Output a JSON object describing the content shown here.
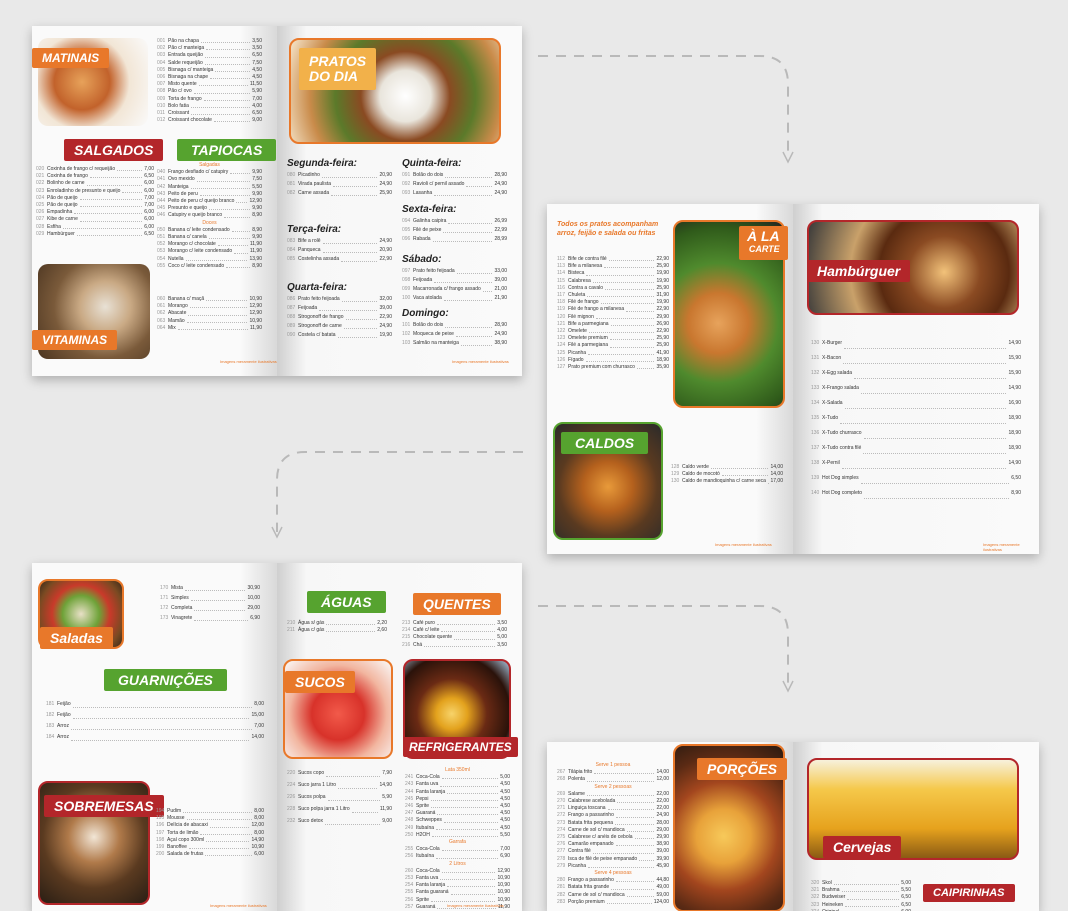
{
  "matinais": {
    "title": "MATINAIS",
    "items": [
      {
        "n": "001",
        "name": "Pão na chapa",
        "price": "3,50"
      },
      {
        "n": "002",
        "name": "Pão c/ manteiga",
        "price": "3,50"
      },
      {
        "n": "003",
        "name": "Entrada queijão",
        "price": "6,50"
      },
      {
        "n": "004",
        "name": "Salde requeijão",
        "price": "7,50"
      },
      {
        "n": "005",
        "name": "Bisnaga c/ manteiga",
        "price": "4,50"
      },
      {
        "n": "006",
        "name": "Bisnaga na chape",
        "price": "4,50"
      },
      {
        "n": "007",
        "name": "Misto quente",
        "price": "11,50"
      },
      {
        "n": "008",
        "name": "Pão c/ ovo",
        "price": "5,90"
      },
      {
        "n": "009",
        "name": "Torta de frango",
        "price": "7,00"
      },
      {
        "n": "010",
        "name": "Bolo fatia",
        "price": "4,00"
      },
      {
        "n": "011",
        "name": "Croissant",
        "price": "6,50"
      },
      {
        "n": "012",
        "name": "Croissant chocolate",
        "price": "9,00"
      }
    ]
  },
  "salgados": {
    "title": "SALGADOS",
    "items": [
      {
        "n": "020",
        "name": "Coxinha de frango c/ requeijão",
        "price": "7,00"
      },
      {
        "n": "021",
        "name": "Coxinha de frango",
        "price": "6,50"
      },
      {
        "n": "022",
        "name": "Bolinho de carne",
        "price": "6,00"
      },
      {
        "n": "023",
        "name": "Enroladinho de presunto e queijo",
        "price": "6,00"
      },
      {
        "n": "024",
        "name": "Pão de queijo",
        "price": "7,00"
      },
      {
        "n": "025",
        "name": "Pão de queijo",
        "price": "7,00"
      },
      {
        "n": "026",
        "name": "Empadinha",
        "price": "6,00"
      },
      {
        "n": "027",
        "name": "Kibe de carne",
        "price": "6,00"
      },
      {
        "n": "028",
        "name": "Esfiha",
        "price": "6,00"
      },
      {
        "n": "029",
        "name": "Hambúrguer",
        "price": "6,50"
      }
    ]
  },
  "tapiocas": {
    "title": "TAPIOCAS",
    "section1": "Salgadas",
    "section2": "Doces",
    "items1": [
      {
        "n": "040",
        "name": "Frango desfiado c/ catupiry",
        "price": "9,90"
      },
      {
        "n": "041",
        "name": "Ovo mexido",
        "price": "7,50"
      },
      {
        "n": "042",
        "name": "Manteiga",
        "price": "5,50"
      },
      {
        "n": "043",
        "name": "Peito de peru",
        "price": "9,90"
      },
      {
        "n": "044",
        "name": "Peito de peru c/ queijo branco",
        "price": "12,90"
      },
      {
        "n": "045",
        "name": "Presunto e queijo",
        "price": "9,90"
      },
      {
        "n": "046",
        "name": "Catupiry e queijo branco",
        "price": "8,90"
      }
    ],
    "items2": [
      {
        "n": "050",
        "name": "Banana c/ leite condensado",
        "price": "8,90"
      },
      {
        "n": "051",
        "name": "Banana c/ canela",
        "price": "9,90"
      },
      {
        "n": "052",
        "name": "Morango c/ chocolate",
        "price": "11,90"
      },
      {
        "n": "053",
        "name": "Morango c/ leite condensado",
        "price": "11,90"
      },
      {
        "n": "054",
        "name": "Nutella",
        "price": "13,90"
      },
      {
        "n": "055",
        "name": "Coco c/ leite condensado",
        "price": "8,90"
      }
    ]
  },
  "vitaminas": {
    "title": "VITAMINAS",
    "items": [
      {
        "n": "060",
        "name": "Banana c/ maçã",
        "price": "10,90"
      },
      {
        "n": "061",
        "name": "Morango",
        "price": "12,90"
      },
      {
        "n": "062",
        "name": "Abacate",
        "price": "12,90"
      },
      {
        "n": "063",
        "name": "Mamão",
        "price": "10,90"
      },
      {
        "n": "064",
        "name": "Mix",
        "price": "11,90"
      }
    ]
  },
  "pratos_do_dia": {
    "title_line1": "PRATOS",
    "title_line2": "DO DIA",
    "segunda": {
      "title": "Segunda-feira:",
      "items": [
        {
          "n": "080",
          "name": "Picadinho",
          "price": "20,90"
        },
        {
          "n": "081",
          "name": "Virada paulista",
          "price": "24,90"
        },
        {
          "n": "082",
          "name": "Carne assada",
          "price": "25,90"
        }
      ]
    },
    "terca": {
      "title": "Terça-feira:",
      "items": [
        {
          "n": "083",
          "name": "Bife a rolê",
          "price": "24,90"
        },
        {
          "n": "084",
          "name": "Panqueca",
          "price": "20,90"
        },
        {
          "n": "085",
          "name": "Costelinha assada",
          "price": "22,90"
        }
      ]
    },
    "quarta": {
      "title": "Quarta-feira:",
      "items": [
        {
          "n": "086",
          "name": "Prato feito feijoada",
          "price": "32,00"
        },
        {
          "n": "087",
          "name": "Feijoada",
          "price": "39,00"
        },
        {
          "n": "088",
          "name": "Strogonoff de frango",
          "price": "22,90"
        },
        {
          "n": "089",
          "name": "Strogonoff de carne",
          "price": "24,90"
        },
        {
          "n": "090",
          "name": "Costela c/ batata",
          "price": "19,90"
        }
      ]
    },
    "quinta": {
      "title": "Quinta-feira:",
      "items": [
        {
          "n": "091",
          "name": "Bolão do dois",
          "price": "28,90"
        },
        {
          "n": "092",
          "name": "Ravioli c/ pernil assado",
          "price": "24,90"
        },
        {
          "n": "093",
          "name": "Lasanha",
          "price": "24,90"
        }
      ]
    },
    "sexta": {
      "title": "Sexta-feira:",
      "items": [
        {
          "n": "094",
          "name": "Galinha caipira",
          "price": "26,99"
        },
        {
          "n": "095",
          "name": "Filé de peixe",
          "price": "22,99"
        },
        {
          "n": "096",
          "name": "Rabada",
          "price": "28,99"
        }
      ]
    },
    "sabado": {
      "title": "Sábado:",
      "items": [
        {
          "n": "097",
          "name": "Prato feito feijoada",
          "price": "33,00"
        },
        {
          "n": "098",
          "name": "Feijoada",
          "price": "39,00"
        },
        {
          "n": "099",
          "name": "Macarronada c/ frango assado",
          "price": "21,00"
        },
        {
          "n": "100",
          "name": "Vaca atolada",
          "price": "21,90"
        }
      ]
    },
    "domingo": {
      "title": "Domingo:",
      "items": [
        {
          "n": "101",
          "name": "Bolão do dois",
          "price": "28,90"
        },
        {
          "n": "102",
          "name": "Moqueca de peixe",
          "price": "24,90"
        },
        {
          "n": "103",
          "name": "Salmão na manteiga",
          "price": "38,90"
        }
      ]
    }
  },
  "a_la_carte": {
    "intro": "Todos os pratos acompanham arroz, feijão e salada ou fritas",
    "title_line1": "À LA",
    "title_line2": "CARTE",
    "items": [
      {
        "n": "112",
        "name": "Bife de contra filé",
        "price": "22,90"
      },
      {
        "n": "113",
        "name": "Bife a milanesa",
        "price": "25,90"
      },
      {
        "n": "114",
        "name": "Bisteca",
        "price": "19,90"
      },
      {
        "n": "115",
        "name": "Calabresa",
        "price": "19,90"
      },
      {
        "n": "116",
        "name": "Contra a cavalo",
        "price": "25,90"
      },
      {
        "n": "117",
        "name": "Chuleta",
        "price": "31,90"
      },
      {
        "n": "118",
        "name": "Filé de frango",
        "price": "19,90"
      },
      {
        "n": "119",
        "name": "Filé de frango a milanesa",
        "price": "22,90"
      },
      {
        "n": "120",
        "name": "Filé mignon",
        "price": "29,90"
      },
      {
        "n": "121",
        "name": "Bife a parmegiana",
        "price": "26,90"
      },
      {
        "n": "122",
        "name": "Omelete",
        "price": "22,90"
      },
      {
        "n": "123",
        "name": "Omelete premium",
        "price": "25,90"
      },
      {
        "n": "124",
        "name": "Filé a parmegiana",
        "price": "25,90"
      },
      {
        "n": "125",
        "name": "Picanha",
        "price": "41,90"
      },
      {
        "n": "126",
        "name": "Fígado",
        "price": "18,90"
      },
      {
        "n": "127",
        "name": "Prato premium com churrasco",
        "price": "35,90"
      }
    ]
  },
  "caldos": {
    "title": "CALDOS",
    "items": [
      {
        "n": "128",
        "name": "Caldo verde",
        "price": "14,00"
      },
      {
        "n": "129",
        "name": "Caldo de mocotó",
        "price": "14,00"
      },
      {
        "n": "130",
        "name": "Caldo de mandioquinha c/ carne seca",
        "price": "17,00"
      }
    ]
  },
  "hamburguer": {
    "title": "Hambúrguer",
    "items": [
      {
        "n": "130",
        "name": "X-Burger",
        "price": "14,90"
      },
      {
        "n": "131",
        "name": "X-Bacon",
        "price": "15,90"
      },
      {
        "n": "132",
        "name": "X-Egg salada",
        "price": "15,90"
      },
      {
        "n": "133",
        "name": "X-Frango salada",
        "price": "14,90"
      },
      {
        "n": "134",
        "name": "X-Salada",
        "price": "16,90"
      },
      {
        "n": "135",
        "name": "X-Tudo",
        "price": "18,90"
      },
      {
        "n": "136",
        "name": "X-Tudo churrasco",
        "price": "18,90"
      },
      {
        "n": "137",
        "name": "X-Tudo contra filé",
        "price": "18,90"
      },
      {
        "n": "138",
        "name": "X-Pernil",
        "price": "14,90"
      },
      {
        "n": "139",
        "name": "Hot Dog simples",
        "price": "6,50"
      },
      {
        "n": "140",
        "name": "Hot Dog completo",
        "price": "8,90"
      }
    ]
  },
  "saladas": {
    "title": "Saladas",
    "items": [
      {
        "n": "170",
        "name": "Mista",
        "price": "30,90"
      },
      {
        "n": "171",
        "name": "Simples",
        "price": "10,00"
      },
      {
        "n": "172",
        "name": "Completa",
        "price": "29,00"
      },
      {
        "n": "173",
        "name": "Vinagrete",
        "price": "6,90"
      }
    ]
  },
  "guarnicoes": {
    "title": "GUARNIÇÕES",
    "items": [
      {
        "n": "181",
        "name": "Feijão",
        "price": "8,00"
      },
      {
        "n": "182",
        "name": "Feijão",
        "price": "15,00"
      },
      {
        "n": "183",
        "name": "Arroz",
        "price": "7,00"
      },
      {
        "n": "184",
        "name": "Arroz",
        "price": "14,00"
      }
    ]
  },
  "sobremesas": {
    "title": "SOBREMESAS",
    "items": [
      {
        "n": "194",
        "name": "Pudim",
        "price": "8,00"
      },
      {
        "n": "195",
        "name": "Mousse",
        "price": "8,00"
      },
      {
        "n": "196",
        "name": "Delícia de abacaxi",
        "price": "12,00"
      },
      {
        "n": "197",
        "name": "Torta de limão",
        "price": "8,00"
      },
      {
        "n": "198",
        "name": "Açaí copo 300ml",
        "price": "14,90"
      },
      {
        "n": "199",
        "name": "Banoffee",
        "price": "10,90"
      },
      {
        "n": "200",
        "name": "Salada de frutas",
        "price": "6,00"
      }
    ]
  },
  "aguas": {
    "title": "ÁGUAS",
    "items": [
      {
        "n": "210",
        "name": "Água s/ gás",
        "price": "2,20"
      },
      {
        "n": "211",
        "name": "Água c/ gás",
        "price": "2,60"
      }
    ]
  },
  "quentes": {
    "title": "QUENTES",
    "items": [
      {
        "n": "213",
        "name": "Café puro",
        "price": "3,50"
      },
      {
        "n": "214",
        "name": "Café c/ leite",
        "price": "4,00"
      },
      {
        "n": "215",
        "name": "Chocolate quente",
        "price": "5,00"
      },
      {
        "n": "216",
        "name": "Chá",
        "price": "3,50"
      }
    ]
  },
  "sucos": {
    "title": "SUCOS",
    "items": [
      {
        "n": "220",
        "name": "Sucos copo",
        "price": "7,90"
      },
      {
        "n": "224",
        "name": "Suco jarra 1 Litro",
        "price": "14,90"
      },
      {
        "n": "226",
        "name": "Sucos polpa",
        "price": "5,90"
      },
      {
        "n": "228",
        "name": "Suco polpa jarra 1 Litro",
        "price": "11,90"
      },
      {
        "n": "232",
        "name": "Suco detox",
        "price": "9,00"
      }
    ]
  },
  "refrigerantes": {
    "title": "REFRIGERANTES",
    "section1": "Lata 350ml",
    "section2": "Garrafa",
    "section3": "2 Litros",
    "items1": [
      {
        "n": "241",
        "name": "Coca-Cola",
        "price": "5,00"
      },
      {
        "n": "243",
        "name": "Fanta uva",
        "price": "4,50"
      },
      {
        "n": "244",
        "name": "Fanta laranja",
        "price": "4,50"
      },
      {
        "n": "245",
        "name": "Pepsi",
        "price": "4,50"
      },
      {
        "n": "246",
        "name": "Sprite",
        "price": "4,50"
      },
      {
        "n": "247",
        "name": "Guaraná",
        "price": "4,50"
      },
      {
        "n": "248",
        "name": "Schweppes",
        "price": "4,50"
      },
      {
        "n": "249",
        "name": "Itubaína",
        "price": "4,50"
      },
      {
        "n": "250",
        "name": "H2OH",
        "price": "5,50"
      }
    ],
    "items2": [
      {
        "n": "255",
        "name": "Coca-Cola",
        "price": "7,00"
      },
      {
        "n": "256",
        "name": "Itubaína",
        "price": "6,90"
      }
    ],
    "items3": [
      {
        "n": "260",
        "name": "Coca-Cola",
        "price": "12,90"
      },
      {
        "n": "253",
        "name": "Fanta uva",
        "price": "10,90"
      },
      {
        "n": "254",
        "name": "Fanta laranja",
        "price": "10,90"
      },
      {
        "n": "255",
        "name": "Fanta guaraná",
        "price": "10,90"
      },
      {
        "n": "256",
        "name": "Sprite",
        "price": "10,90"
      },
      {
        "n": "257",
        "name": "Guaraná",
        "price": "11,90"
      }
    ]
  },
  "porcoes": {
    "title": "PORÇÕES",
    "section1": "Serve 1 pessoa",
    "section2": "Serve 2 pessoas",
    "section3": "Serve 4 pessoas",
    "items1": [
      {
        "n": "267",
        "name": "Tilápia frito",
        "price": "14,00"
      },
      {
        "n": "268",
        "name": "Polenta",
        "price": "12,00"
      }
    ],
    "items2": [
      {
        "n": "269",
        "name": "Salame",
        "price": "22,00"
      },
      {
        "n": "270",
        "name": "Calabrese acebolada",
        "price": "22,00"
      },
      {
        "n": "271",
        "name": "Linguiça toscana",
        "price": "22,00"
      },
      {
        "n": "272",
        "name": "Frango a passarinho",
        "price": "24,90"
      },
      {
        "n": "273",
        "name": "Batata frita pequena",
        "price": "28,00"
      },
      {
        "n": "274",
        "name": "Carne de sol c/ mandioca",
        "price": "29,00"
      },
      {
        "n": "275",
        "name": "Calabrese c/ anéis de cebola",
        "price": "29,90"
      },
      {
        "n": "276",
        "name": "Camarão empanado",
        "price": "38,90"
      },
      {
        "n": "277",
        "name": "Contra filé",
        "price": "39,00"
      },
      {
        "n": "278",
        "name": "Isca de filé de peixe empanado",
        "price": "39,90"
      },
      {
        "n": "279",
        "name": "Picanha",
        "price": "45,90"
      }
    ],
    "items3": [
      {
        "n": "280",
        "name": "Frango a passarinho",
        "price": "44,80"
      },
      {
        "n": "281",
        "name": "Batata frita grande",
        "price": "49,00"
      },
      {
        "n": "282",
        "name": "Carne de sol c/ mandioca",
        "price": "59,00"
      },
      {
        "n": "283",
        "name": "Porção premium",
        "price": "124,00"
      }
    ]
  },
  "cervejas": {
    "title": "Cervejas",
    "items": [
      {
        "n": "320",
        "name": "Skol",
        "price": "5,00"
      },
      {
        "n": "321",
        "name": "Brahma",
        "price": "5,50"
      },
      {
        "n": "322",
        "name": "Budweiser",
        "price": "6,50"
      },
      {
        "n": "323",
        "name": "Heineken",
        "price": "6,50"
      },
      {
        "n": "324",
        "name": "Original",
        "price": "6,00"
      }
    ]
  },
  "caipirinhas": {
    "title": "CAIPIRINHAS"
  },
  "footnote": "Imagens meramente ilustrativas",
  "colors": {
    "orange": "#e8782a",
    "red": "#b3262a",
    "green": "#56a32f",
    "background": "#e9e9e9"
  }
}
